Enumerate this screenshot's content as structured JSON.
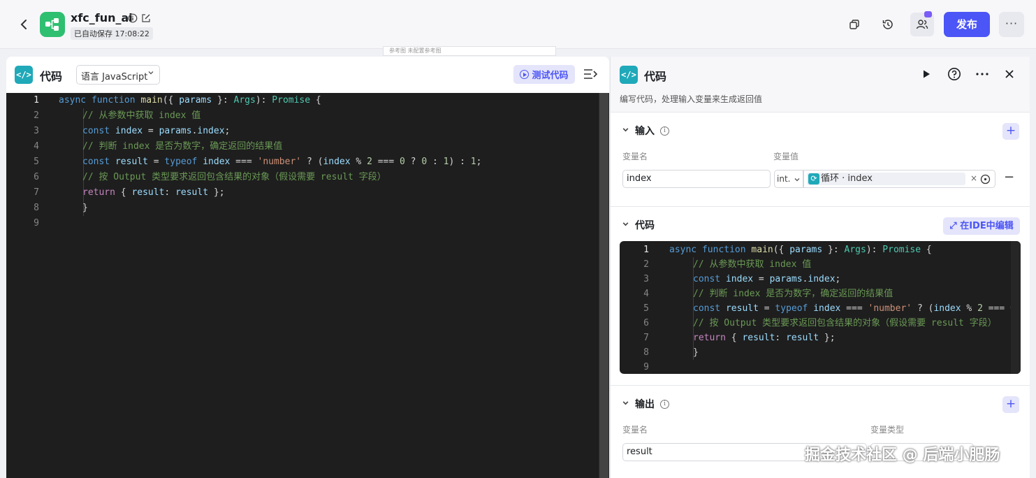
{
  "header": {
    "app_name": "xfc_fun_ai",
    "saved_status": "已自动保存 17:08:22",
    "publish_label": "发布"
  },
  "canvas": {
    "hint": "参考图  未配置参考图"
  },
  "ide": {
    "title": "代码",
    "language": "语言 JavaScript",
    "test_label": "测试代码",
    "line_numbers": [
      "1",
      "2",
      "3",
      "4",
      "5",
      "6",
      "7",
      "8",
      "9"
    ],
    "code": [
      "async function main({ params }: Args): Promise {",
      "    // 从参数中获取 index 值",
      "    const index = params.index;",
      "    // 判断 index 是否为数字，确定返回的结果值",
      "    const result = typeof index === 'number' ? (index % 2 === 0 ? 0 : 1) : 1;",
      "    // 按 Output 类型要求返回包含结果的对象（假设需要 result 字段）",
      "    return { result: result };",
      "    }",
      ""
    ]
  },
  "panel": {
    "title": "代码",
    "description": "编写代码，处理输入变量来生成返回值",
    "input": {
      "title": "输入",
      "col_name": "变量名",
      "col_value": "变量值",
      "var_name": "index",
      "var_type": "int.",
      "ref_label": "循环 · index"
    },
    "code": {
      "title": "代码",
      "ide_button": "在IDE中编辑"
    },
    "output": {
      "title": "输出",
      "col_name": "变量名",
      "col_type": "变量类型",
      "var_name": "result"
    }
  },
  "watermark": "掘金技术社区 @ 后端小肥肠",
  "colors": {
    "accent": "#4c55f5",
    "brand_green": "#2fbf71",
    "code_icon": "#1fa9b9",
    "editor_bg": "#1e1e1e"
  }
}
